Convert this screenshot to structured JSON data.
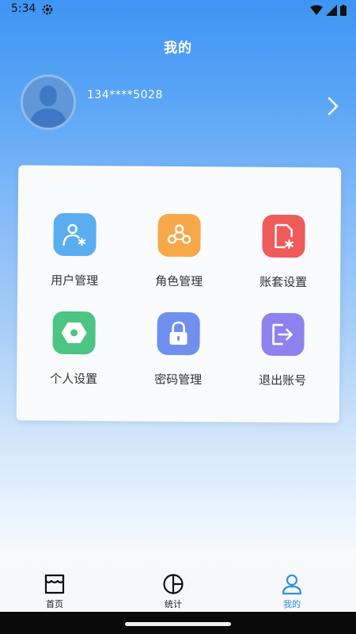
{
  "status": {
    "time": "5:34"
  },
  "header": {
    "title": "我的"
  },
  "profile": {
    "phone": "134****5028"
  },
  "menu": [
    {
      "label": "用户管理",
      "icon": "user-manage-icon",
      "color": "#5aaef0"
    },
    {
      "label": "角色管理",
      "icon": "role-manage-icon",
      "color": "#f7a94a"
    },
    {
      "label": "账套设置",
      "icon": "account-set-icon",
      "color": "#ef5a5a"
    },
    {
      "label": "个人设置",
      "icon": "personal-settings-icon",
      "color": "#4cc483"
    },
    {
      "label": "密码管理",
      "icon": "password-lock-icon",
      "color": "#6f90ee"
    },
    {
      "label": "退出账号",
      "icon": "logout-icon",
      "color": "#8d82ee"
    }
  ],
  "tabs": [
    {
      "label": "首页",
      "icon": "shop-icon",
      "active": false
    },
    {
      "label": "统计",
      "icon": "pie-chart-icon",
      "active": false
    },
    {
      "label": "我的",
      "icon": "person-icon",
      "active": true
    }
  ],
  "colors": {
    "active_tab": "#2f8fe8",
    "header_blue": "#3f95f4"
  }
}
